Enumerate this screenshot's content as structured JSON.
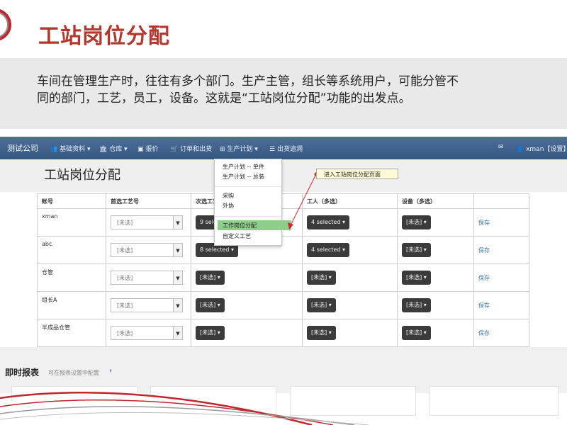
{
  "slide": {
    "title": "工站岗位分配",
    "intro_line1": "车间在管理生产时，往往有多个部门。生产主管，组长等系统用户，可能分管不",
    "intro_line2": "同的部门，工艺，员工，设备。这就是“工站岗位分配”功能的出发点。"
  },
  "app": {
    "brand": "测试公司",
    "nav": [
      {
        "label": "基础资料 ▾",
        "icon": "users-icon"
      },
      {
        "label": "仓库 ▾",
        "icon": "bank-icon"
      },
      {
        "label": "报价",
        "icon": "money-icon"
      },
      {
        "label": "订单和出货",
        "icon": "cart-icon"
      },
      {
        "label": "生产计划 ▾",
        "icon": "sitemap-icon"
      },
      {
        "label": "出货追溯",
        "icon": "list-icon"
      }
    ],
    "user": "xman【设置】▾",
    "page_title": "工站岗位分配",
    "table": {
      "headers": [
        "帐号",
        "首选工艺号",
        "次选工艺",
        "工人（多选）",
        "设备（多选）",
        ""
      ],
      "rows": [
        {
          "account": "xman",
          "primary": "[未选]",
          "secondary": "9 selected ▾",
          "workers": "4 selected ▾",
          "equipment": "[未选] ▾",
          "action": "保存"
        },
        {
          "account": "abc",
          "primary": "[未选]",
          "secondary": "8 selected ▾",
          "workers": "4 selected ▾",
          "equipment": "[未选] ▾",
          "action": "保存"
        },
        {
          "account": "仓管",
          "primary": "[未选]",
          "secondary": "[未选] ▾",
          "workers": "[未选] ▾",
          "equipment": "[未选] ▾",
          "action": "保存"
        },
        {
          "account": "组长A",
          "primary": "[未选]",
          "secondary": "[未选] ▾",
          "workers": "[未选] ▾",
          "equipment": "[未选] ▾",
          "action": "保存"
        },
        {
          "account": "半成品仓管",
          "primary": "[未选]",
          "secondary": "[未选] ▾",
          "workers": "[未选] ▾",
          "equipment": "[未选] ▾",
          "action": "保存"
        }
      ]
    },
    "dropdown": {
      "items": [
        "生产计划 -- 单件",
        "生产计划 -- 总装",
        "采购",
        "外协",
        "工作岗位分配",
        "自定义工艺"
      ],
      "highlighted": "工作岗位分配"
    },
    "callout": "进入工站岗位分配页面",
    "report": {
      "title": "即时报表",
      "subtitle": "可在报表设置中配置"
    }
  },
  "colors": {
    "title_red": "#b5372b",
    "nav_blue": "#3f6290",
    "highlight_green": "#8fce8a",
    "link_blue": "#3572b0"
  }
}
